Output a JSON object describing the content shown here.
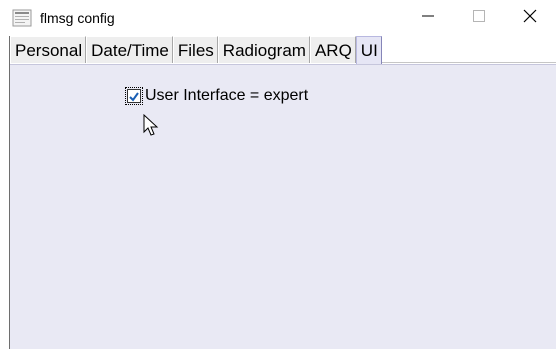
{
  "window": {
    "title": "flmsg config",
    "icons": {
      "app": "flmsg-app-icon",
      "minimize": "minimize-icon",
      "maximize": "maximize-icon",
      "close": "close-icon"
    }
  },
  "tabs": [
    {
      "label": "Personal",
      "active": false
    },
    {
      "label": "Date/Time",
      "active": false
    },
    {
      "label": "Files",
      "active": false
    },
    {
      "label": "Radiogram",
      "active": false
    },
    {
      "label": "ARQ",
      "active": false
    },
    {
      "label": "UI",
      "active": true
    }
  ],
  "ui_panel": {
    "checkbox_label": "User Interface = expert",
    "checkbox_checked": true
  },
  "colors": {
    "panel_bg": "#e9e9f4",
    "tab_bg": "#eeeeee",
    "active_tab_bg": "#e6e6f5",
    "check_accent": "#1a5fb4"
  }
}
